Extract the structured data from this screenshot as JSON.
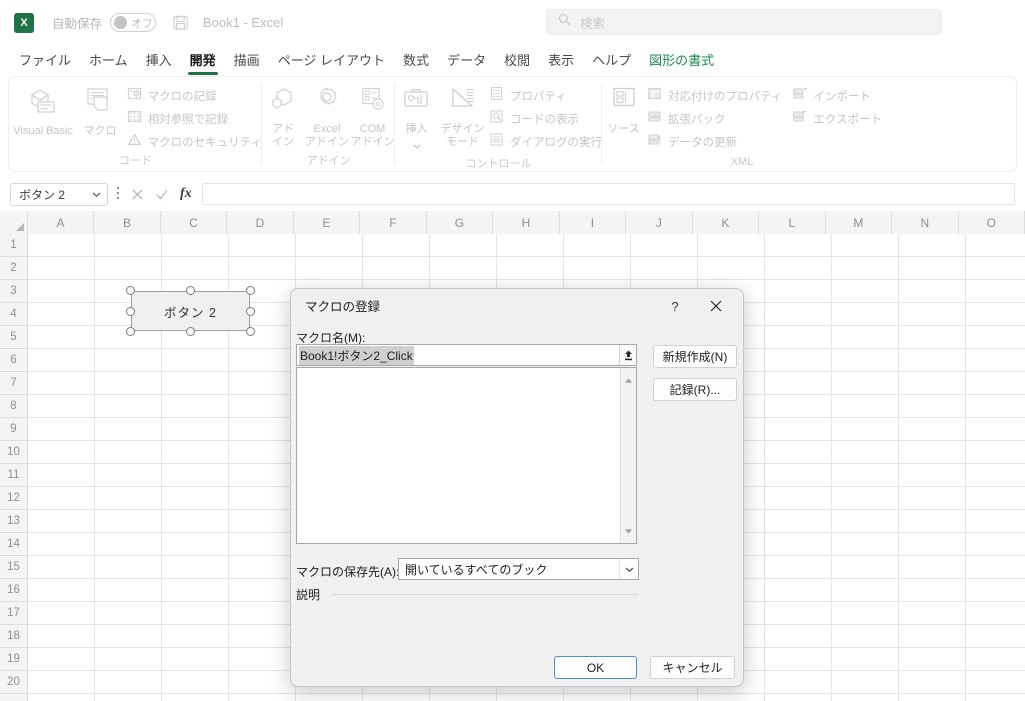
{
  "titlebar": {
    "app_logo": "excel-logo",
    "autosave_label": "自動保存",
    "autosave_state": "オフ",
    "save_icon": "save-icon",
    "document_title": "Book1  -  Excel",
    "search_placeholder": "検索",
    "search_icon": "search-icon"
  },
  "tabs": [
    {
      "label": "ファイル",
      "active": false
    },
    {
      "label": "ホーム",
      "active": false
    },
    {
      "label": "挿入",
      "active": false
    },
    {
      "label": "開発",
      "active": true
    },
    {
      "label": "描画",
      "active": false
    },
    {
      "label": "ページ レイアウト",
      "active": false
    },
    {
      "label": "数式",
      "active": false
    },
    {
      "label": "データ",
      "active": false
    },
    {
      "label": "校閲",
      "active": false
    },
    {
      "label": "表示",
      "active": false
    },
    {
      "label": "ヘルプ",
      "active": false
    },
    {
      "label": "図形の書式",
      "active": false,
      "contextual": true
    }
  ],
  "ribbon": {
    "groups": [
      {
        "title": "コード",
        "big": [
          {
            "label": "Visual Basic",
            "icon": "visual-basic-icon"
          },
          {
            "label": "マクロ",
            "icon": "macro-icon"
          }
        ],
        "small": [
          {
            "label": "マクロの記録",
            "icon": "record-macro-icon"
          },
          {
            "label": "相対参照で記録",
            "icon": "relative-reference-icon"
          },
          {
            "label": "マクロのセキュリティ",
            "icon": "macro-security-icon"
          }
        ]
      },
      {
        "title": "アドイン",
        "big": [
          {
            "label": "アド\nイン",
            "icon": "addins-icon"
          },
          {
            "label": "Excel\nアドイン",
            "icon": "excel-addins-icon"
          },
          {
            "label": "COM\nアドイン",
            "icon": "com-addins-icon"
          }
        ],
        "small": []
      },
      {
        "title": "コントロール",
        "big": [
          {
            "label": "挿入",
            "icon": "insert-control-icon",
            "dropdown": true
          },
          {
            "label": "デザイン\nモード",
            "icon": "design-mode-icon"
          }
        ],
        "small": [
          {
            "label": "プロパティ",
            "icon": "properties-icon"
          },
          {
            "label": "コードの表示",
            "icon": "view-code-icon"
          },
          {
            "label": "ダイアログの実行",
            "icon": "run-dialog-icon"
          }
        ]
      },
      {
        "title": "XML",
        "big": [
          {
            "label": "ソース",
            "icon": "xml-source-icon"
          }
        ],
        "small": [
          {
            "label": "対応付けのプロパティ",
            "icon": "map-properties-icon"
          },
          {
            "label": "拡張パック",
            "icon": "expansion-packs-icon"
          },
          {
            "label": "データの更新",
            "icon": "refresh-data-icon"
          }
        ],
        "small2": [
          {
            "label": "インポート",
            "icon": "import-icon"
          },
          {
            "label": "エクスポート",
            "icon": "export-icon"
          }
        ]
      }
    ]
  },
  "formula_bar": {
    "name_box_value": "ボタン 2",
    "name_box_arrow": "chevron-down-icon",
    "more_icon": "more-vertical-icon",
    "cancel_icon": "cancel-formula-icon",
    "confirm_icon": "confirm-formula-icon",
    "fx_label": "fx",
    "input_value": ""
  },
  "grid": {
    "columns": [
      "A",
      "B",
      "C",
      "D",
      "E",
      "F",
      "G",
      "H",
      "I",
      "J",
      "K",
      "L",
      "M",
      "N",
      "O"
    ],
    "rows": [
      1,
      2,
      3,
      4,
      5,
      6,
      7,
      8,
      9,
      10,
      11,
      12,
      13,
      14,
      15,
      16,
      17,
      18,
      19,
      20
    ]
  },
  "shape": {
    "label": "ボタン 2",
    "selected": true,
    "handle_count": 8
  },
  "dialog": {
    "title": "マクロの登録",
    "help_icon": "?",
    "close_icon": "close-icon",
    "macro_name_label": "マクロ名(M):",
    "macro_name_value": "Book1!ボタン2_Click",
    "spin_icon": "spin-up-icon",
    "list_items": [],
    "scroll_up_icon": "scroll-up-arrow",
    "scroll_down_icon": "scroll-down-arrow",
    "new_button": "新規作成(N)",
    "record_button": "記録(R)...",
    "store_label": "マクロの保存先(A):",
    "store_value": "開いているすべてのブック",
    "store_arrow": "chevron-down-icon",
    "description_label": "説明",
    "ok_button": "OK",
    "cancel_button": "キャンセル"
  },
  "colors": {
    "excel_green": "#217346",
    "contextual_tab": "#1f8a4c",
    "focus_blue": "#4a90d9",
    "dialog_bg": "#f0f0f0",
    "grid_line": "#e4e4e4",
    "header_bg": "#f4f4f4",
    "selection_highlight": "#cfcfcf"
  }
}
